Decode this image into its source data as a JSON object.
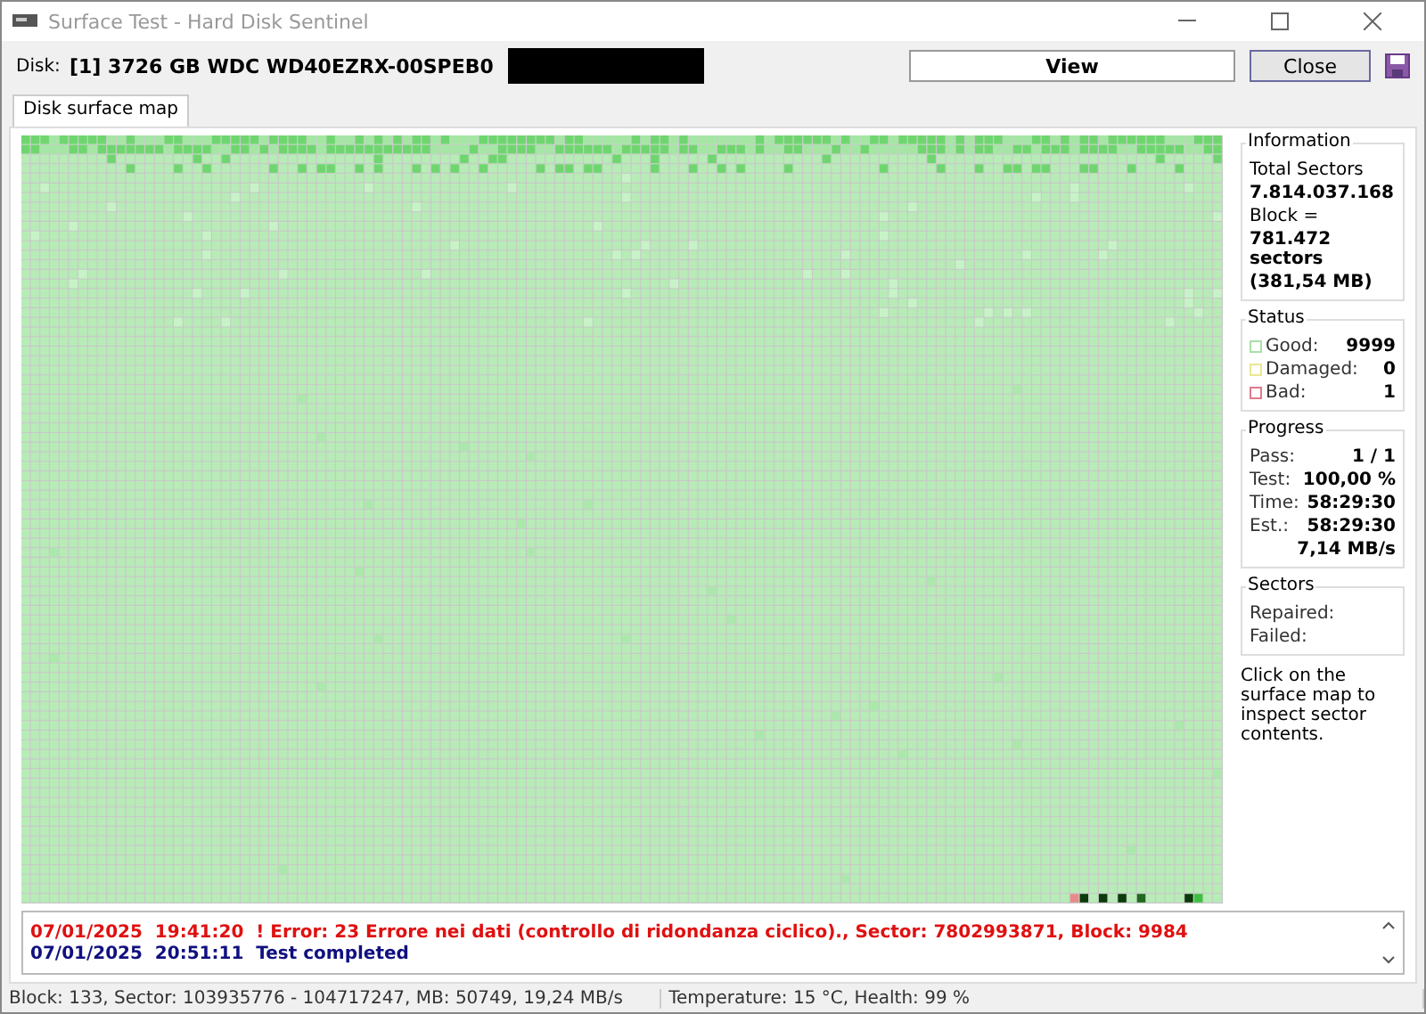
{
  "window": {
    "title": "Surface Test - Hard Disk Sentinel"
  },
  "disk": {
    "label": "Disk:",
    "value": "[1] 3726 GB  WDC WD40EZRX-00SPEB0"
  },
  "buttons": [
    {
      "label": "View",
      "kind": "view"
    },
    {
      "label": "Close",
      "kind": "close"
    }
  ],
  "tabs": [
    {
      "label": "Disk surface map",
      "selected": true
    }
  ],
  "information": {
    "title": "Information",
    "total_label": "Total Sectors",
    "total_value": "7.814.037.168",
    "block_label": "Block =",
    "block_sectors": "781.472 sectors",
    "block_size": "(381,54 MB)"
  },
  "status": {
    "title": "Status",
    "items": [
      {
        "label": "Good:",
        "value": "9999",
        "color": "#a8e0a8"
      },
      {
        "label": "Damaged:",
        "value": "0",
        "color": "#e8e890"
      },
      {
        "label": "Bad:",
        "value": "1",
        "color": "#e07a8a"
      }
    ]
  },
  "progress": {
    "title": "Progress",
    "rows": [
      {
        "label": "Pass:",
        "value": "1 / 1"
      },
      {
        "label": "Test:",
        "value": "100,00 %"
      },
      {
        "label": "Time:",
        "value": "58:29:30"
      },
      {
        "label": "Est.:",
        "value": "58:29:30"
      }
    ],
    "speed": "7,14 MB/s"
  },
  "sectors": {
    "title": "Sectors",
    "rows": [
      "Repaired:",
      "Failed:"
    ]
  },
  "hint": "Click on the surface map to inspect sector contents.",
  "log": [
    {
      "date": "07/01/2025",
      "time": "19:41:20",
      "message": "! Error: 23 Errore nei dati (controllo di ridondanza ciclico)., Sector: 7802993871, Block: 9984",
      "kind": "error"
    },
    {
      "date": "07/01/2025",
      "time": "20:51:11",
      "message": "Test completed",
      "kind": "info"
    }
  ],
  "status_bar": [
    "Block: 133, Sector: 103935776 - 104717247, MB: 50749, 19,24 MB/s",
    "Temperature: 15  °C,  Health: 99 %"
  ]
}
